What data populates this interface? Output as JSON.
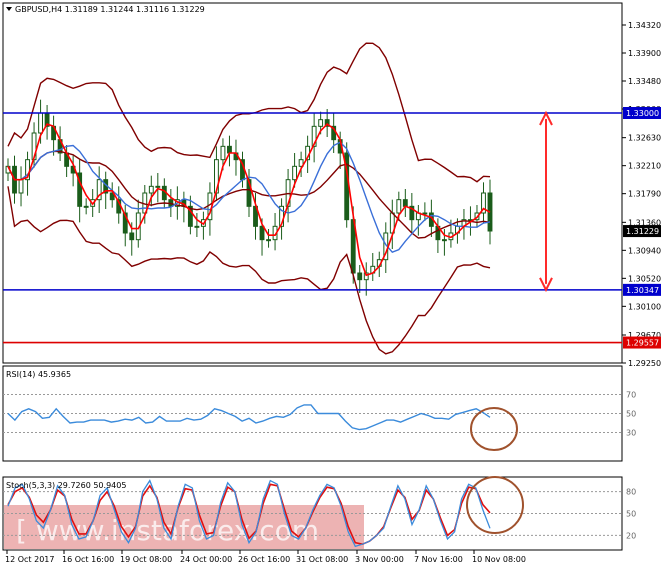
{
  "chart_data": [
    {
      "type": "candlestick",
      "panel": "main",
      "symbol_line": "GBPUSD,H4  1.31189 1.31244 1.31116 1.31229",
      "ylim": [
        1.2925,
        1.3465
      ],
      "y_ticks": [
        "1.34320",
        "1.33900",
        "1.33480",
        "1.33060",
        "1.32630",
        "1.32210",
        "1.31790",
        "1.31360",
        "1.30940",
        "1.30520",
        "1.30100",
        "1.29670",
        "1.29250"
      ],
      "close_series_approx": [
        1.322,
        1.318,
        1.32,
        1.323,
        1.327,
        1.33,
        1.328,
        1.326,
        1.324,
        1.322,
        1.321,
        1.316,
        1.316,
        1.317,
        1.32,
        1.318,
        1.317,
        1.315,
        1.312,
        1.311,
        1.315,
        1.318,
        1.319,
        1.319,
        1.317,
        1.316,
        1.317,
        1.316,
        1.313,
        1.313,
        1.314,
        1.318,
        1.323,
        1.325,
        1.324,
        1.323,
        1.32,
        1.316,
        1.313,
        1.311,
        1.311,
        1.313,
        1.316,
        1.32,
        1.322,
        1.323,
        1.325,
        1.328,
        1.329,
        1.328,
        1.326,
        1.324,
        1.314,
        1.306,
        1.305,
        1.306,
        1.307,
        1.308,
        1.312,
        1.315,
        1.317,
        1.316,
        1.314,
        1.315,
        1.315,
        1.313,
        1.311,
        1.311,
        1.312,
        1.313,
        1.314,
        1.314,
        1.315,
        1.318,
        1.3123
      ],
      "current_price": "1.31229",
      "horizontal_lines": [
        {
          "value": 1.33,
          "label": "1.33000",
          "color": "#0000cc"
        },
        {
          "value": 1.30347,
          "label": "1.30347",
          "color": "#0000cc"
        },
        {
          "value": 1.29557,
          "label": "1.29557",
          "color": "#dd0000"
        }
      ],
      "x_labels": [
        "12 Oct 2017",
        "16 Oct 16:00",
        "19 Oct 08:00",
        "24 Oct 00:00",
        "26 Oct 16:00",
        "31 Oct 08:00",
        "3 Nov 00:00",
        "7 Nov 16:00",
        "10 Nov 08:00"
      ],
      "colors": {
        "candle": "#1a5c1a",
        "bollinger": "#800000",
        "ma_fast": "#ff0000",
        "ma_slow": "#3a6fd8",
        "arrow": "#ff2a2a"
      }
    },
    {
      "type": "line",
      "panel": "rsi",
      "label": "RSI(14) 45.9365",
      "ylim": [
        0,
        100
      ],
      "levels": [
        30,
        50,
        70
      ],
      "values_approx": [
        50,
        43,
        52,
        55,
        52,
        45,
        46,
        55,
        47,
        40,
        41,
        41,
        43,
        43,
        43,
        41,
        42,
        44,
        43,
        46,
        40,
        41,
        47,
        42,
        42,
        42,
        45,
        43,
        44,
        48,
        55,
        53,
        50,
        47,
        42,
        45,
        40,
        42,
        45,
        47,
        46,
        49,
        56,
        59,
        59,
        50,
        50,
        50,
        50,
        42,
        35,
        33,
        34,
        37,
        40,
        43,
        43,
        41,
        44,
        47,
        50,
        48,
        45,
        45,
        44,
        49,
        51,
        53,
        55,
        51,
        46
      ]
    },
    {
      "type": "line",
      "panel": "stochastic",
      "label": "Stoch(5,3,3) 29.7260 50.9405",
      "ylim": [
        0,
        100
      ],
      "levels": [
        20,
        50,
        80
      ],
      "k_values_approx": [
        60,
        85,
        90,
        70,
        40,
        30,
        55,
        88,
        75,
        35,
        15,
        18,
        40,
        75,
        85,
        55,
        25,
        10,
        30,
        80,
        95,
        70,
        30,
        15,
        60,
        90,
        85,
        40,
        15,
        20,
        65,
        92,
        80,
        35,
        10,
        25,
        70,
        95,
        90,
        50,
        20,
        15,
        30,
        55,
        75,
        90,
        85,
        60,
        25,
        5,
        8,
        12,
        20,
        30,
        60,
        88,
        70,
        35,
        55,
        88,
        70,
        40,
        15,
        25,
        70,
        90,
        85,
        55,
        29.726
      ],
      "d_values_approx": [
        62,
        80,
        85,
        72,
        48,
        38,
        55,
        82,
        74,
        42,
        22,
        22,
        40,
        68,
        80,
        60,
        32,
        18,
        32,
        74,
        88,
        72,
        38,
        22,
        58,
        84,
        82,
        48,
        22,
        24,
        60,
        86,
        80,
        42,
        16,
        26,
        64,
        90,
        88,
        56,
        26,
        18,
        30,
        52,
        72,
        86,
        84,
        64,
        32,
        10,
        8,
        12,
        20,
        32,
        58,
        82,
        72,
        42,
        54,
        82,
        70,
        44,
        20,
        28,
        64,
        86,
        84,
        62,
        50.9405
      ]
    }
  ],
  "watermark": "[ www.instaforex.com"
}
